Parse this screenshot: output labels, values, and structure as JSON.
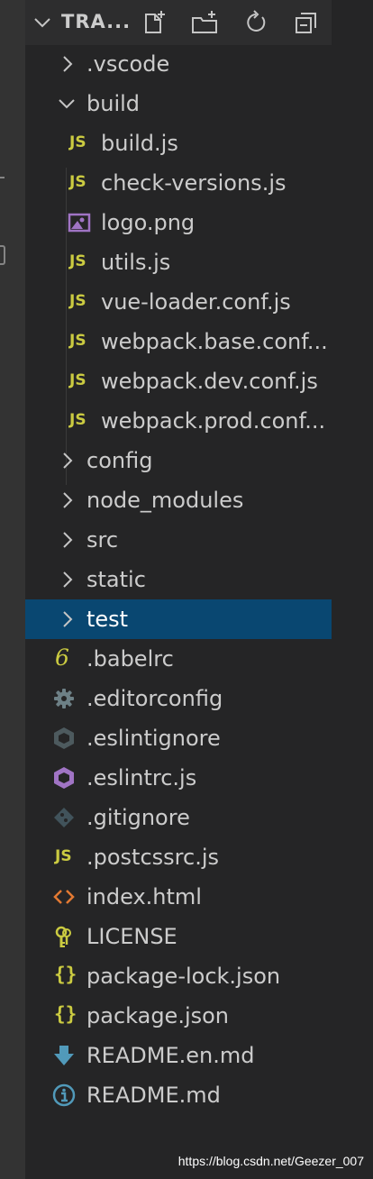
{
  "explorer": {
    "title": "TRA...",
    "toolbar": [
      {
        "name": "new-file-icon"
      },
      {
        "name": "new-folder-icon"
      },
      {
        "name": "refresh-icon"
      },
      {
        "name": "collapse-all-icon"
      }
    ]
  },
  "tree": {
    "items": [
      {
        "label": ".vscode",
        "type": "folder",
        "expanded": false
      },
      {
        "label": "build",
        "type": "folder",
        "expanded": true
      },
      {
        "label": "build.js",
        "type": "js"
      },
      {
        "label": "check-versions.js",
        "type": "js"
      },
      {
        "label": "logo.png",
        "type": "image"
      },
      {
        "label": "utils.js",
        "type": "js"
      },
      {
        "label": "vue-loader.conf.js",
        "type": "js"
      },
      {
        "label": "webpack.base.conf...",
        "type": "js"
      },
      {
        "label": "webpack.dev.conf.js",
        "type": "js"
      },
      {
        "label": "webpack.prod.conf...",
        "type": "js"
      },
      {
        "label": "config",
        "type": "folder",
        "expanded": false
      },
      {
        "label": "node_modules",
        "type": "folder",
        "expanded": false
      },
      {
        "label": "src",
        "type": "folder",
        "expanded": false
      },
      {
        "label": "static",
        "type": "folder",
        "expanded": false
      },
      {
        "label": "test",
        "type": "folder",
        "expanded": false,
        "selected": true
      },
      {
        "label": ".babelrc",
        "type": "babel"
      },
      {
        "label": ".editorconfig",
        "type": "gear"
      },
      {
        "label": ".eslintignore",
        "type": "eslint-gray"
      },
      {
        "label": ".eslintrc.js",
        "type": "eslint-purple"
      },
      {
        "label": ".gitignore",
        "type": "git"
      },
      {
        "label": ".postcssrc.js",
        "type": "js"
      },
      {
        "label": "index.html",
        "type": "html"
      },
      {
        "label": "LICENSE",
        "type": "license"
      },
      {
        "label": "package-lock.json",
        "type": "json"
      },
      {
        "label": "package.json",
        "type": "json"
      },
      {
        "label": "README.en.md",
        "type": "download"
      },
      {
        "label": "README.md",
        "type": "info"
      }
    ]
  },
  "icons": {
    "js_badge": "JS",
    "json_braces": "{}",
    "babel_glyph": "6"
  },
  "colors": {
    "sidebar_bg": "#252526",
    "activity_bar_bg": "#333333",
    "selection_bg": "#094771",
    "text": "#cccccc",
    "js_yellow": "#cbcb41",
    "html_orange": "#e37933",
    "image_purple": "#a074c4",
    "eslint_purple": "#a074c4",
    "markdown_blue": "#519aba",
    "gear_gray": "#6d8086"
  },
  "watermark": "https://blog.csdn.net/Geezer_007"
}
